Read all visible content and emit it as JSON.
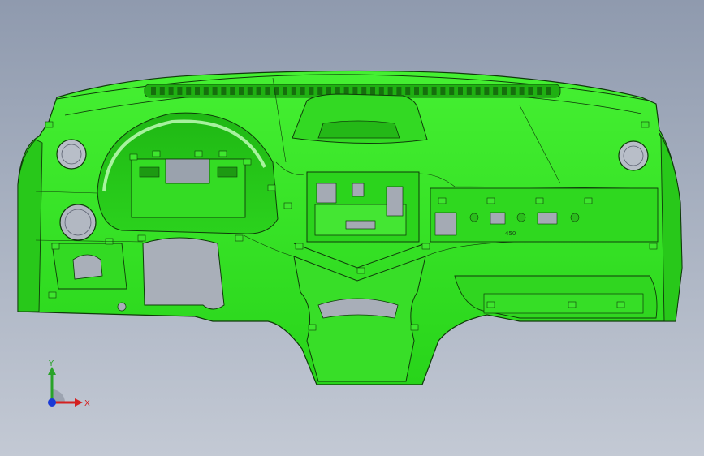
{
  "viewport": {
    "background_top": "#8f9aae",
    "background_bottom": "#c3c9d4"
  },
  "model": {
    "name_icon": "dashboard-cad-model",
    "body_color": "#2ee51f",
    "edge_color": "#0f3a0a",
    "part_label": "450"
  },
  "triad": {
    "x_label": "X",
    "y_label": "Y",
    "x_color": "#d42020",
    "y_color": "#29a329",
    "z_color": "#1a3ad6"
  }
}
